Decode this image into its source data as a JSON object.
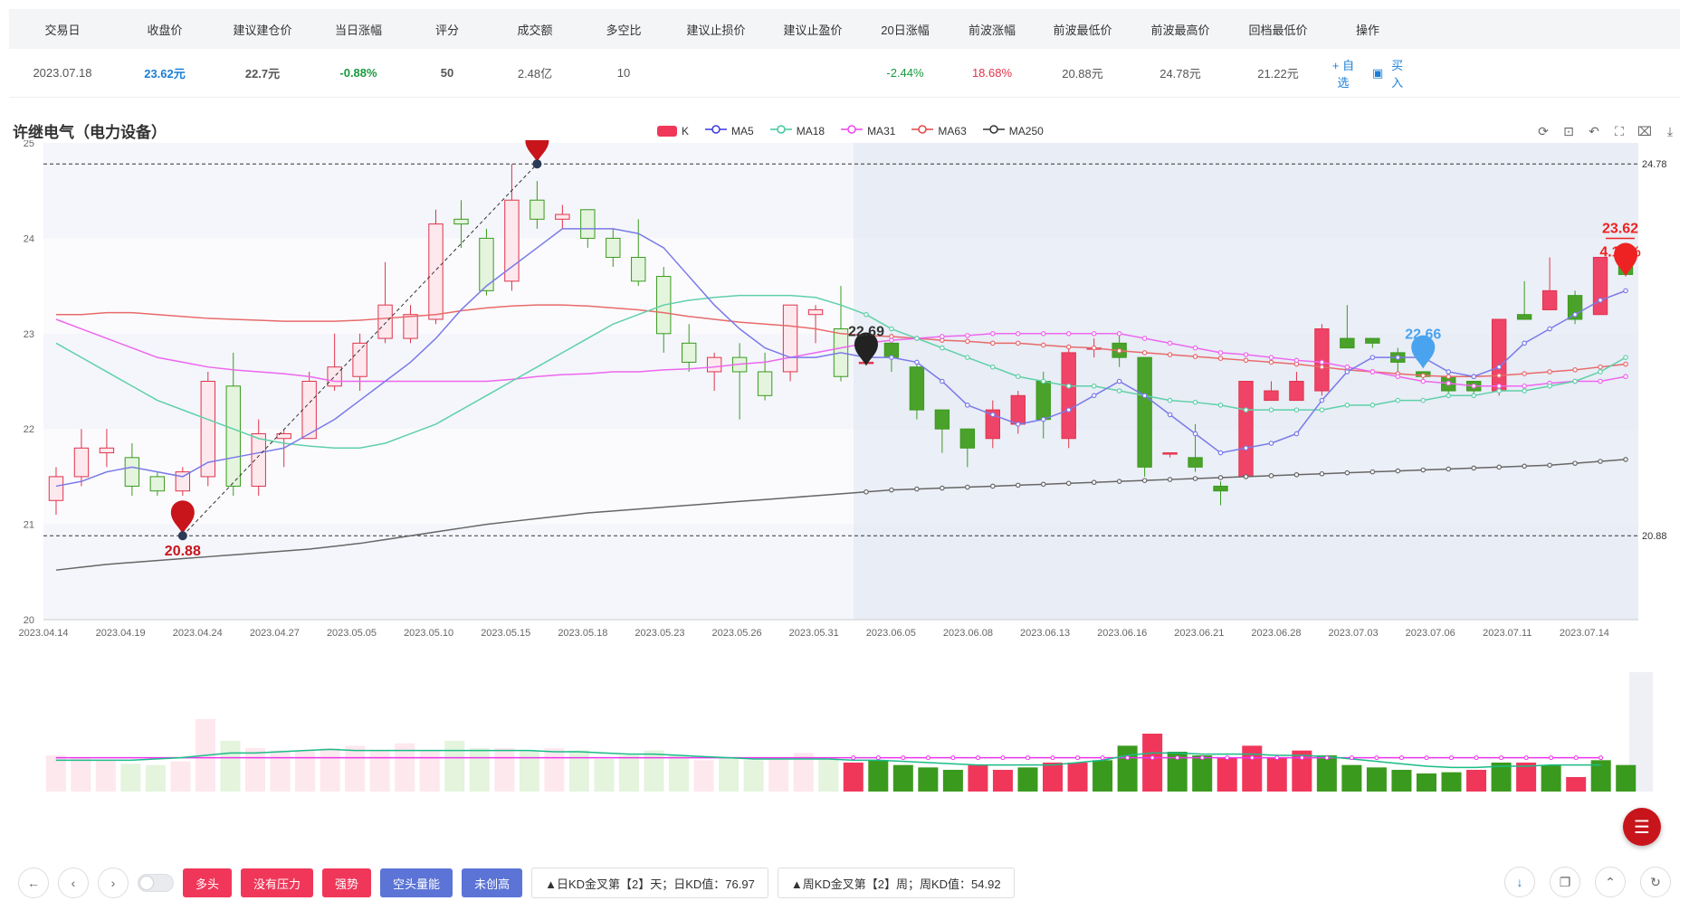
{
  "summary": {
    "headers": [
      "交易日",
      "收盘价",
      "建议建仓价",
      "当日涨幅",
      "评分",
      "成交额",
      "多空比",
      "建议止损价",
      "建议止盈价",
      "20日涨幅",
      "前波涨幅",
      "前波最低价",
      "前波最高价",
      "回档最低价",
      "操作"
    ],
    "values": [
      "2023.07.18",
      "23.62元",
      "22.7元",
      "-0.88%",
      "50",
      "2.48亿",
      "10",
      "",
      "",
      "-2.44%",
      "18.68%",
      "20.88元",
      "24.78元",
      "21.22元",
      ""
    ],
    "op_add": "+ 自选",
    "op_buy": "买入"
  },
  "stock_title": "许继电气（电力设备）",
  "legend": [
    {
      "name": "K",
      "color": "#f0375a",
      "type": "box"
    },
    {
      "name": "MA5",
      "color": "#3a3ae0",
      "type": "line"
    },
    {
      "name": "MA18",
      "color": "#3fc9a0",
      "type": "line"
    },
    {
      "name": "MA31",
      "color": "#ee44ee",
      "type": "line"
    },
    {
      "name": "MA63",
      "color": "#e54545",
      "type": "line"
    },
    {
      "name": "MA250",
      "color": "#333333",
      "type": "line"
    }
  ],
  "tool_icons": [
    "refresh-icon",
    "zoom-area-icon",
    "zoom-back-icon",
    "restore-icon",
    "brush-icon",
    "download-icon"
  ],
  "chart_data": {
    "type": "candlestick",
    "ylim": [
      20,
      25
    ],
    "yticks": [
      "20",
      "21",
      "22",
      "23",
      "24",
      "25"
    ],
    "xticks": [
      "2023.04.14",
      "2023.04.19",
      "2023.04.24",
      "2023.04.27",
      "2023.05.05",
      "2023.05.10",
      "2023.05.15",
      "2023.05.18",
      "2023.05.23",
      "2023.05.26",
      "2023.05.31",
      "2023.06.05",
      "2023.06.08",
      "2023.06.13",
      "2023.06.16",
      "2023.06.21",
      "2023.06.28",
      "2023.07.03",
      "2023.07.06",
      "2023.07.11",
      "2023.07.14"
    ],
    "hlines": [
      {
        "value": 24.78,
        "label": "24.78"
      },
      {
        "value": 20.88,
        "label": "20.88"
      }
    ],
    "candles": [
      [
        21.25,
        21.5,
        21.1,
        21.6
      ],
      [
        21.5,
        21.8,
        21.4,
        22.0
      ],
      [
        21.75,
        21.8,
        21.6,
        22.0
      ],
      [
        21.7,
        21.4,
        21.3,
        21.85
      ],
      [
        21.5,
        21.35,
        21.3,
        21.55
      ],
      [
        21.35,
        21.55,
        21.3,
        21.6
      ],
      [
        21.5,
        22.5,
        21.4,
        22.6
      ],
      [
        22.45,
        21.4,
        21.3,
        22.8
      ],
      [
        21.4,
        21.95,
        21.3,
        22.1
      ],
      [
        21.9,
        21.95,
        21.6,
        22.0
      ],
      [
        21.9,
        22.5,
        21.9,
        22.6
      ],
      [
        22.45,
        22.65,
        22.4,
        23.0
      ],
      [
        22.55,
        22.9,
        22.4,
        23.0
      ],
      [
        22.95,
        23.3,
        22.9,
        23.75
      ],
      [
        22.95,
        23.2,
        22.9,
        23.3
      ],
      [
        23.15,
        24.15,
        23.1,
        24.3
      ],
      [
        24.2,
        24.15,
        23.9,
        24.4
      ],
      [
        24.0,
        23.45,
        23.4,
        24.1
      ],
      [
        23.55,
        24.4,
        23.45,
        24.78
      ],
      [
        24.4,
        24.2,
        24.1,
        24.6
      ],
      [
        24.2,
        24.25,
        24.1,
        24.35
      ],
      [
        24.3,
        24.0,
        23.9,
        24.3
      ],
      [
        24.0,
        23.8,
        23.7,
        24.1
      ],
      [
        23.8,
        23.55,
        23.5,
        24.2
      ],
      [
        23.6,
        23.0,
        22.8,
        23.7
      ],
      [
        22.9,
        22.7,
        22.6,
        23.1
      ],
      [
        22.6,
        22.75,
        22.4,
        22.8
      ],
      [
        22.75,
        22.6,
        22.1,
        22.9
      ],
      [
        22.6,
        22.35,
        22.3,
        22.8
      ],
      [
        22.6,
        23.3,
        22.5,
        23.3
      ],
      [
        23.2,
        23.25,
        22.9,
        23.3
      ],
      [
        23.05,
        22.55,
        22.5,
        23.5
      ],
      [
        22.7,
        22.7,
        22.7,
        22.7
      ],
      [
        22.9,
        22.75,
        22.6,
        23.0
      ],
      [
        22.65,
        22.2,
        22.1,
        22.7
      ],
      [
        22.2,
        22.0,
        21.75,
        22.2
      ],
      [
        22.0,
        21.8,
        21.6,
        22.0
      ],
      [
        21.9,
        22.2,
        21.8,
        22.3
      ],
      [
        22.05,
        22.35,
        21.95,
        22.4
      ],
      [
        22.5,
        22.1,
        21.9,
        22.6
      ],
      [
        21.9,
        22.8,
        21.8,
        22.85
      ],
      [
        22.85,
        22.85,
        22.75,
        22.95
      ],
      [
        22.9,
        22.75,
        22.65,
        23.0
      ],
      [
        22.75,
        21.6,
        21.5,
        22.75
      ],
      [
        21.75,
        21.75,
        21.7,
        21.75
      ],
      [
        21.7,
        21.6,
        21.55,
        22.05
      ],
      [
        21.4,
        21.35,
        21.2,
        21.45
      ],
      [
        21.5,
        22.5,
        21.5,
        22.5
      ],
      [
        22.3,
        22.4,
        22.3,
        22.5
      ],
      [
        22.3,
        22.5,
        22.3,
        22.6
      ],
      [
        22.4,
        23.05,
        22.35,
        23.1
      ],
      [
        22.95,
        22.85,
        22.85,
        23.3
      ],
      [
        22.95,
        22.9,
        22.85,
        22.95
      ],
      [
        22.8,
        22.7,
        22.6,
        22.85
      ],
      [
        22.6,
        22.55,
        22.5,
        22.6
      ],
      [
        22.55,
        22.4,
        22.35,
        22.55
      ],
      [
        22.5,
        22.4,
        22.35,
        22.5
      ],
      [
        22.4,
        23.15,
        22.35,
        23.15
      ],
      [
        23.2,
        23.15,
        23.15,
        23.55
      ],
      [
        23.25,
        23.45,
        23.25,
        23.8
      ],
      [
        23.4,
        23.15,
        23.1,
        23.45
      ],
      [
        23.2,
        23.8,
        23.2,
        23.8
      ],
      [
        23.7,
        23.62,
        23.6,
        23.9
      ]
    ],
    "ma5": [
      21.4,
      21.45,
      21.55,
      21.6,
      21.55,
      21.5,
      21.65,
      21.7,
      21.75,
      21.8,
      21.95,
      22.1,
      22.3,
      22.5,
      22.7,
      22.95,
      23.25,
      23.5,
      23.7,
      23.9,
      24.1,
      24.1,
      24.1,
      24.05,
      23.9,
      23.6,
      23.3,
      23.05,
      22.85,
      22.75,
      22.75,
      22.8,
      22.75,
      22.75,
      22.7,
      22.5,
      22.25,
      22.15,
      22.05,
      22.1,
      22.2,
      22.35,
      22.5,
      22.35,
      22.15,
      21.95,
      21.75,
      21.8,
      21.85,
      21.95,
      22.3,
      22.6,
      22.75,
      22.75,
      22.75,
      22.6,
      22.55,
      22.65,
      22.9,
      23.05,
      23.2,
      23.35,
      23.45
    ],
    "ma18": [
      22.9,
      22.75,
      22.6,
      22.45,
      22.3,
      22.2,
      22.1,
      22.0,
      21.9,
      21.85,
      21.82,
      21.8,
      21.8,
      21.85,
      21.95,
      22.05,
      22.2,
      22.35,
      22.5,
      22.65,
      22.8,
      22.95,
      23.1,
      23.2,
      23.3,
      23.35,
      23.38,
      23.4,
      23.4,
      23.4,
      23.38,
      23.3,
      23.2,
      23.05,
      22.95,
      22.85,
      22.75,
      22.65,
      22.55,
      22.5,
      22.45,
      22.45,
      22.4,
      22.35,
      22.3,
      22.28,
      22.25,
      22.2,
      22.2,
      22.2,
      22.2,
      22.25,
      22.25,
      22.3,
      22.3,
      22.35,
      22.35,
      22.4,
      22.4,
      22.45,
      22.5,
      22.6,
      22.75
    ],
    "ma31": [
      23.15,
      23.05,
      22.95,
      22.85,
      22.75,
      22.7,
      22.65,
      22.62,
      22.6,
      22.58,
      22.55,
      22.5,
      22.5,
      22.5,
      22.5,
      22.5,
      22.5,
      22.5,
      22.52,
      22.55,
      22.57,
      22.58,
      22.6,
      22.6,
      22.62,
      22.63,
      22.65,
      22.68,
      22.7,
      22.75,
      22.8,
      22.85,
      22.9,
      22.93,
      22.95,
      22.97,
      22.98,
      23.0,
      23.0,
      23.0,
      23.0,
      23.0,
      23.0,
      22.95,
      22.9,
      22.85,
      22.8,
      22.78,
      22.75,
      22.72,
      22.7,
      22.65,
      22.6,
      22.55,
      22.5,
      22.48,
      22.45,
      22.45,
      22.45,
      22.48,
      22.5,
      22.5,
      22.55
    ],
    "ma63": [
      23.2,
      23.2,
      23.22,
      23.22,
      23.2,
      23.18,
      23.16,
      23.15,
      23.14,
      23.13,
      23.13,
      23.13,
      23.14,
      23.16,
      23.18,
      23.2,
      23.24,
      23.27,
      23.29,
      23.3,
      23.3,
      23.29,
      23.27,
      23.25,
      23.22,
      23.18,
      23.15,
      23.12,
      23.1,
      23.08,
      23.05,
      23.0,
      22.98,
      22.97,
      22.95,
      22.93,
      22.92,
      22.9,
      22.9,
      22.88,
      22.86,
      22.85,
      22.82,
      22.8,
      22.78,
      22.76,
      22.74,
      22.72,
      22.7,
      22.68,
      22.65,
      22.62,
      22.6,
      22.58,
      22.56,
      22.55,
      22.55,
      22.56,
      22.58,
      22.6,
      22.62,
      22.65,
      22.68
    ],
    "ma250": [
      20.52,
      20.55,
      20.58,
      20.6,
      20.62,
      20.64,
      20.66,
      20.68,
      20.7,
      20.72,
      20.74,
      20.77,
      20.8,
      20.84,
      20.88,
      20.92,
      20.96,
      21.0,
      21.03,
      21.06,
      21.09,
      21.12,
      21.14,
      21.16,
      21.18,
      21.2,
      21.22,
      21.24,
      21.26,
      21.28,
      21.3,
      21.32,
      21.34,
      21.36,
      21.37,
      21.38,
      21.39,
      21.4,
      21.41,
      21.42,
      21.43,
      21.44,
      21.45,
      21.46,
      21.47,
      21.48,
      21.49,
      21.5,
      21.51,
      21.52,
      21.53,
      21.54,
      21.55,
      21.56,
      21.57,
      21.58,
      21.59,
      21.6,
      21.61,
      21.62,
      21.64,
      21.66,
      21.68
    ],
    "markers": [
      {
        "label": "24.78",
        "value": 24.78,
        "index": 19,
        "color": "#c8141b"
      },
      {
        "label": "20.88",
        "value": 20.88,
        "index": 5,
        "color": "#c8141b"
      },
      {
        "label": "22.69",
        "value": 22.69,
        "index": 32,
        "color": "#222222"
      },
      {
        "label": "22.66",
        "value": 22.66,
        "index": 54,
        "color": "#4aa3ee"
      },
      {
        "label": "23.62",
        "sub": "4.10%",
        "value": 23.62,
        "index": 62,
        "color": "#ee2222"
      }
    ],
    "volume": [
      30,
      28,
      26,
      23,
      22,
      25,
      60,
      42,
      36,
      34,
      34,
      36,
      38,
      34,
      40,
      34,
      42,
      36,
      36,
      34,
      36,
      34,
      27,
      30,
      34,
      30,
      26,
      28,
      26,
      28,
      32,
      28,
      24,
      26,
      22,
      20,
      18,
      22,
      18,
      20,
      24,
      24,
      26,
      38,
      48,
      33,
      30,
      28,
      38,
      28,
      34,
      30,
      22,
      20,
      18,
      15,
      16,
      18,
      24,
      24,
      22,
      12,
      26,
      22
    ],
    "vol_ma1": [
      26,
      26,
      26,
      26,
      27,
      28,
      30,
      32,
      32,
      33,
      34,
      35,
      34,
      34,
      34,
      34,
      34,
      34,
      34,
      34,
      33,
      33,
      32,
      31,
      31,
      30,
      29,
      28,
      27,
      27,
      27,
      27,
      26,
      26,
      25,
      24,
      23,
      22,
      22,
      22,
      22,
      24,
      26,
      30,
      32,
      32,
      31,
      31,
      31,
      30,
      30,
      29,
      27,
      25,
      23,
      21,
      20,
      20,
      21,
      21,
      22,
      22,
      22
    ],
    "vol_ma2": [
      28,
      28,
      28,
      28,
      28,
      28,
      28,
      28,
      28,
      28,
      28,
      28,
      28,
      28,
      28,
      28,
      28,
      28,
      28,
      28,
      28,
      28,
      28,
      28,
      28,
      28,
      28,
      28,
      28,
      28,
      28,
      28,
      28,
      28,
      28,
      28,
      28,
      28,
      28,
      28,
      28,
      28,
      28,
      28,
      28,
      28,
      28,
      28,
      28,
      28,
      28,
      28,
      28,
      28,
      28,
      28,
      28,
      28,
      28,
      28,
      28,
      28,
      28
    ]
  },
  "bottom": {
    "tags": [
      {
        "label": "多头",
        "color": "red"
      },
      {
        "label": "没有压力",
        "color": "red"
      },
      {
        "label": "强势",
        "color": "red"
      },
      {
        "label": "空头量能",
        "color": "purple"
      },
      {
        "label": "未创高",
        "color": "purple"
      }
    ],
    "kd_day": "▲日KD金叉第【2】天；日KD值：76.97",
    "kd_week": "▲周KD金叉第【2】周；周KD值：54.92"
  }
}
